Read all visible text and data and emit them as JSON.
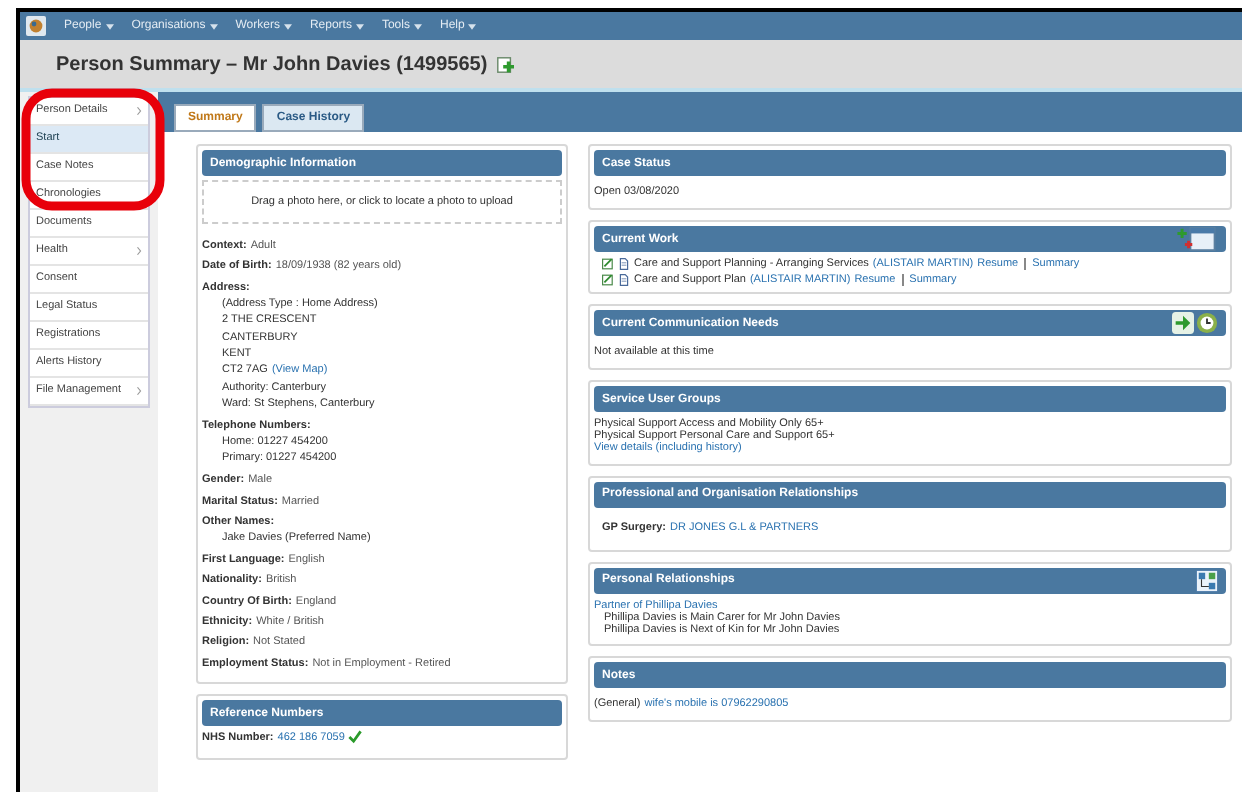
{
  "nav": {
    "menus": [
      "People",
      "Organisations",
      "Workers",
      "Reports",
      "Tools",
      "Help"
    ]
  },
  "title": "Person Summary – Mr John Davies (1499565)",
  "sidebar": {
    "items": [
      {
        "label": "Person Details",
        "submenu": true,
        "selected": false
      },
      {
        "label": "Start",
        "submenu": false,
        "selected": true
      },
      {
        "label": "Case Notes",
        "submenu": false,
        "selected": false
      },
      {
        "label": "Chronologies",
        "submenu": false,
        "selected": false
      },
      {
        "label": "Documents",
        "submenu": false,
        "selected": false
      },
      {
        "label": "Health",
        "submenu": true,
        "selected": false
      },
      {
        "label": "Consent",
        "submenu": false,
        "selected": false
      },
      {
        "label": "Legal Status",
        "submenu": false,
        "selected": false
      },
      {
        "label": "Registrations",
        "submenu": false,
        "selected": false
      },
      {
        "label": "Alerts History",
        "submenu": false,
        "selected": false
      },
      {
        "label": "File Management",
        "submenu": true,
        "selected": false
      }
    ]
  },
  "tabs": [
    {
      "label": "Summary",
      "selected": true
    },
    {
      "label": "Case History",
      "selected": false
    }
  ],
  "demographics": {
    "title": "Demographic Information",
    "photo_hint": "Drag a photo here, or click to locate a photo to upload",
    "fields": [
      {
        "label": "Context:",
        "value": "Adult"
      },
      {
        "label": "Date of Birth:",
        "value": "18/09/1938 (82 years old)"
      },
      {
        "label": "Address:",
        "lines": [
          {
            "text": "(Address Type : Home Address)"
          },
          {
            "text": "2 THE CRESCENT"
          },
          {
            "text": "CANTERBURY"
          },
          {
            "text": "KENT"
          },
          {
            "text": "CT2 7AG",
            "link": "(View Map)"
          },
          {
            "text": "Authority: Canterbury"
          },
          {
            "text": "Ward: St Stephens, Canterbury"
          }
        ]
      },
      {
        "label": "Telephone Numbers:",
        "lines": [
          {
            "text": "Home: 01227 454200"
          },
          {
            "text": "Primary: 01227 454200"
          }
        ]
      },
      {
        "label": "Gender:",
        "value": "Male"
      },
      {
        "label": "Marital Status:",
        "value": "Married"
      },
      {
        "label": "Other Names:",
        "lines": [
          {
            "text": "Jake Davies (Preferred Name)"
          }
        ]
      },
      {
        "label": "First Language:",
        "value": "English"
      },
      {
        "label": "Nationality:",
        "value": "British"
      },
      {
        "label": "Country Of Birth:",
        "value": "England"
      },
      {
        "label": "Ethnicity:",
        "value": "White / British"
      },
      {
        "label": "Religion:",
        "value": "Not Stated"
      },
      {
        "label": "Employment Status:",
        "value": "Not in Employment - Retired"
      }
    ]
  },
  "reference": {
    "title": "Reference Numbers",
    "label": "NHS Number:",
    "value": "462 186 7059",
    "verified": true
  },
  "case_status": {
    "title": "Case Status",
    "text": "Open 03/08/2020"
  },
  "current_work": {
    "title": "Current Work",
    "items": [
      {
        "text": "Care and Support Planning - Arranging Services",
        "worker": "(ALISTAIR MARTIN)",
        "resume": "Resume",
        "summary": "Summary"
      },
      {
        "text": "Care and Support Plan",
        "worker": "(ALISTAIR MARTIN)",
        "resume": "Resume",
        "summary": "Summary"
      }
    ]
  },
  "communication": {
    "title": "Current Communication Needs",
    "text": "Not available at this time"
  },
  "service_groups": {
    "title": "Service User Groups",
    "lines": [
      "Physical Support Access and Mobility Only 65+",
      "Physical Support Personal Care and Support 65+"
    ],
    "link": "View details (including history)"
  },
  "professional": {
    "title": "Professional and Organisation Relationships",
    "label": "GP Surgery:",
    "value": "DR JONES G.L & PARTNERS"
  },
  "personal": {
    "title": "Personal Relationships",
    "link": "Partner of Phillipa Davies",
    "lines": [
      "Phillipa Davies is Main Carer for Mr John Davies",
      "Phillipa Davies is Next of Kin for Mr John Davies"
    ]
  },
  "notes": {
    "title": "Notes",
    "prefix": "(General)",
    "link": "wife's mobile is 07962290805"
  }
}
